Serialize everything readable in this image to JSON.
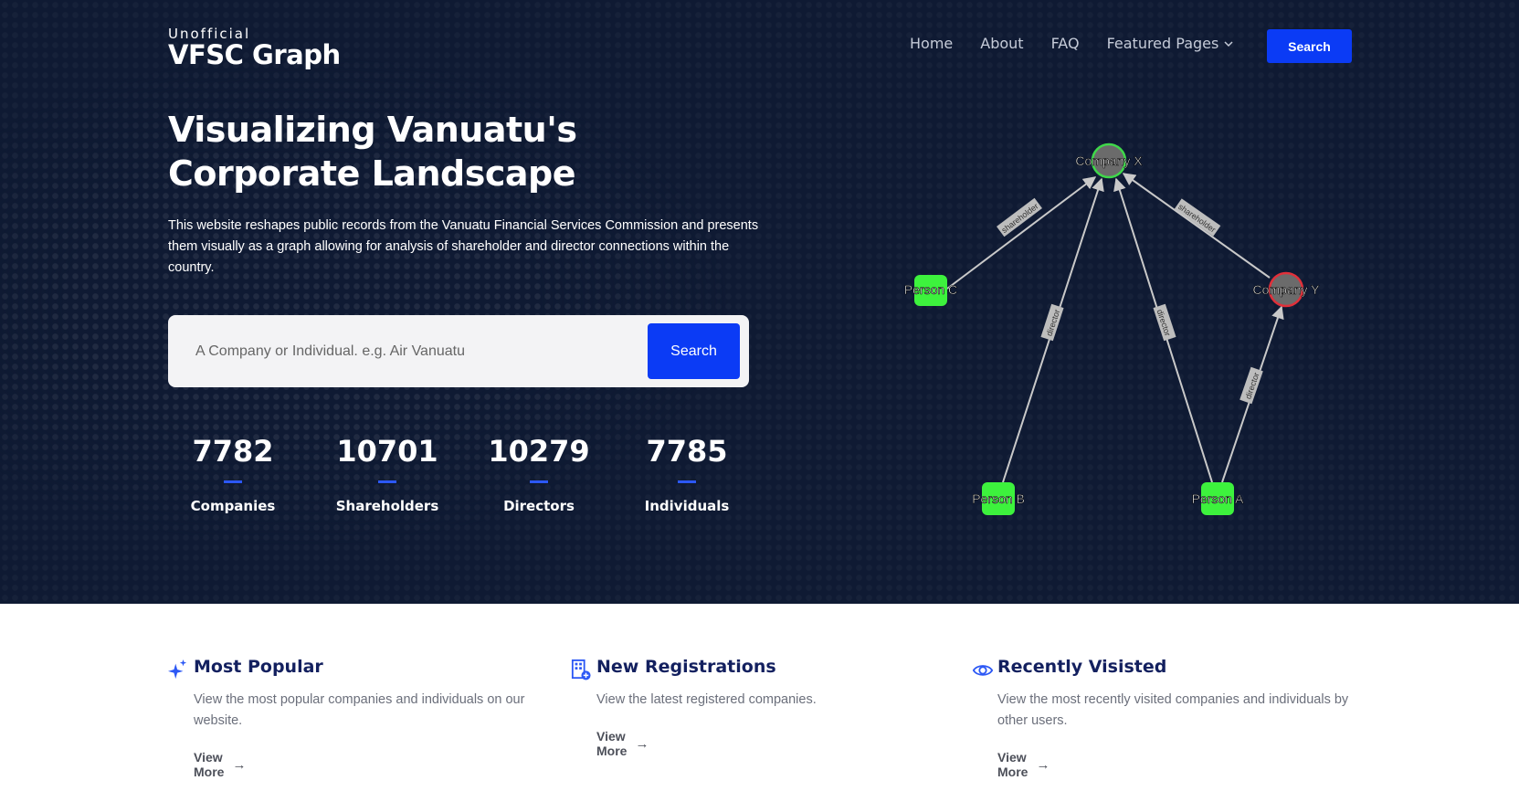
{
  "brand": {
    "small": "Unofficial",
    "big": "VFSC Graph"
  },
  "nav": {
    "items": [
      "Home",
      "About",
      "FAQ",
      "Featured Pages"
    ],
    "search_label": "Search"
  },
  "hero": {
    "title_line1": "Visualizing Vanuatu's",
    "title_line2": "Corporate Landscape",
    "description": "This website reshapes public records from the Vanuatu Financial Services Commission and presents them visually as a graph allowing for analysis of shareholder and director connections within the country.",
    "search_placeholder": "A Company or Individual. e.g. Air Vanuatu",
    "search_button": "Search"
  },
  "stats": [
    {
      "value": "7782",
      "label": "Companies"
    },
    {
      "value": "10701",
      "label": "Shareholders"
    },
    {
      "value": "10279",
      "label": "Directors"
    },
    {
      "value": "7785",
      "label": "Individuals"
    }
  ],
  "graph": {
    "nodes": {
      "company_x": "Company X",
      "company_y": "Company Y",
      "person_a": "Person A",
      "person_b": "Person B",
      "person_c": "Person C"
    },
    "edges": {
      "c_to_x": "shareholder",
      "y_to_x": "shareholder",
      "b_to_x": "director",
      "a_to_x": "director",
      "a_to_y": "director"
    },
    "colors": {
      "person": "#3df23d",
      "company_x_ring": "#3fd84a",
      "company_y_ring": "#e0303a",
      "company_fill": "#6b6b6b",
      "edge": "#c9c9c9"
    }
  },
  "features": [
    {
      "icon": "sparkles-icon",
      "title": "Most Popular",
      "description": "View the most popular companies and individuals on our website.",
      "link": "View More"
    },
    {
      "icon": "building-add-icon",
      "title": "New Registrations",
      "description": "View the latest registered companies.",
      "link": "View More"
    },
    {
      "icon": "eye-icon",
      "title": "Recently Visisted",
      "description": "View the most recently visited companies and individuals by other users.",
      "link": "View More"
    }
  ]
}
